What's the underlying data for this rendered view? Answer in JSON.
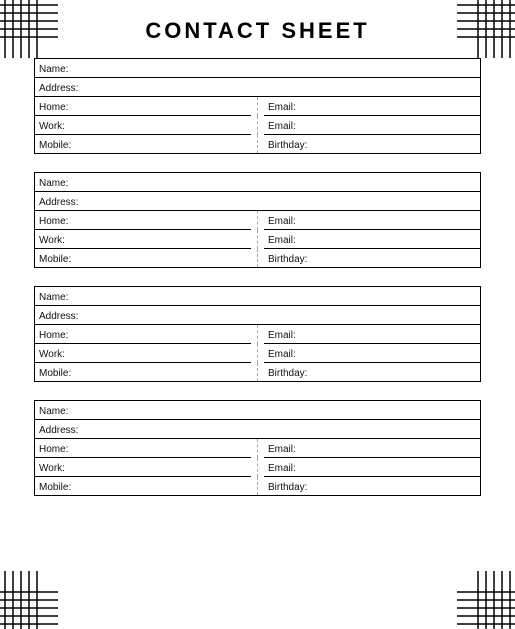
{
  "title": "CONTACT SHEET",
  "labels": {
    "name": "Name:",
    "address": "Address:",
    "home": "Home:",
    "work": "Work:",
    "mobile": "Mobile:",
    "email": "Email:",
    "birthday": "Birthday:"
  },
  "cards": [
    {
      "name": "",
      "address": "",
      "home": "",
      "work": "",
      "mobile": "",
      "email1": "",
      "email2": "",
      "birthday": ""
    },
    {
      "name": "",
      "address": "",
      "home": "",
      "work": "",
      "mobile": "",
      "email1": "",
      "email2": "",
      "birthday": ""
    },
    {
      "name": "",
      "address": "",
      "home": "",
      "work": "",
      "mobile": "",
      "email1": "",
      "email2": "",
      "birthday": ""
    },
    {
      "name": "",
      "address": "",
      "home": "",
      "work": "",
      "mobile": "",
      "email1": "",
      "email2": "",
      "birthday": ""
    }
  ]
}
